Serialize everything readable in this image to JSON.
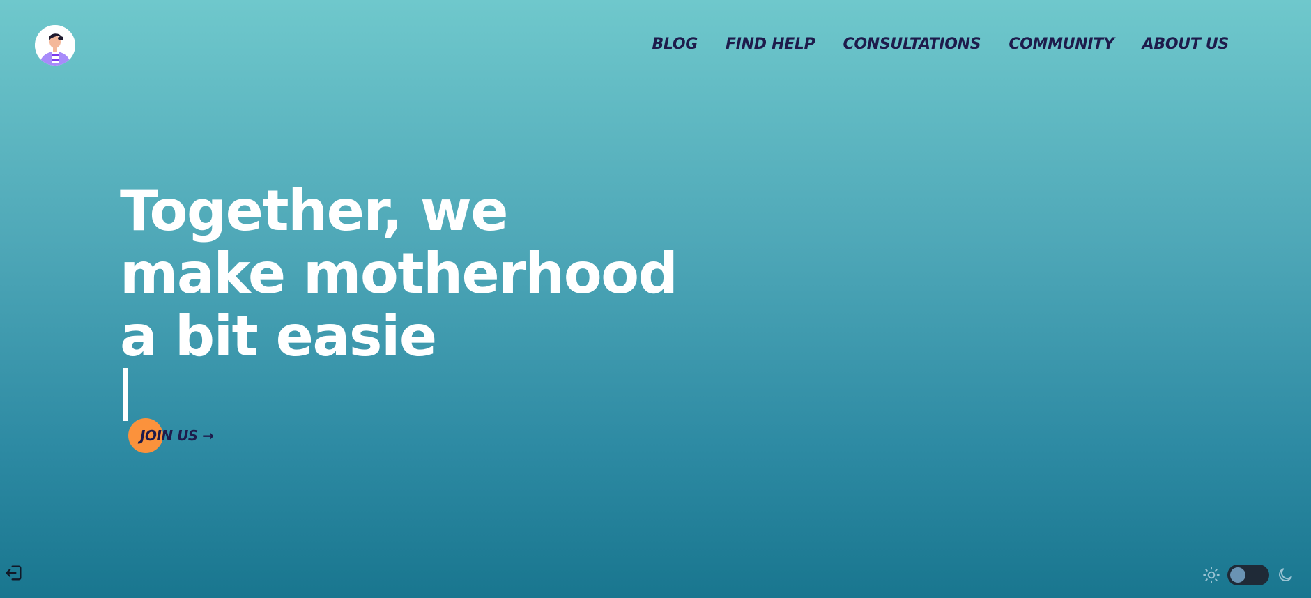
{
  "header": {
    "logo_icon": "avatar-icon",
    "nav": [
      {
        "label": "BLOG"
      },
      {
        "label": "FIND HELP"
      },
      {
        "label": "CONSULTATIONS"
      },
      {
        "label": "COMMUNITY"
      },
      {
        "label": "ABOUT US"
      }
    ]
  },
  "hero": {
    "line1": "Together, we",
    "line2": "make motherhood",
    "line3": "a bit easie",
    "cta_label": "JOIN US →"
  },
  "footer": {
    "logout_icon": "logout-icon",
    "theme_light_icon": "sun-icon",
    "theme_dark_icon": "moon-icon"
  },
  "colors": {
    "background_top": "#6fc8cc",
    "background_bottom": "#19768f",
    "nav_text": "#1e1b4b",
    "hero_text": "#ffffff",
    "cta_accent": "#fb923c",
    "toggle_track": "#1f2a37",
    "toggle_knob": "#6a93b3"
  }
}
